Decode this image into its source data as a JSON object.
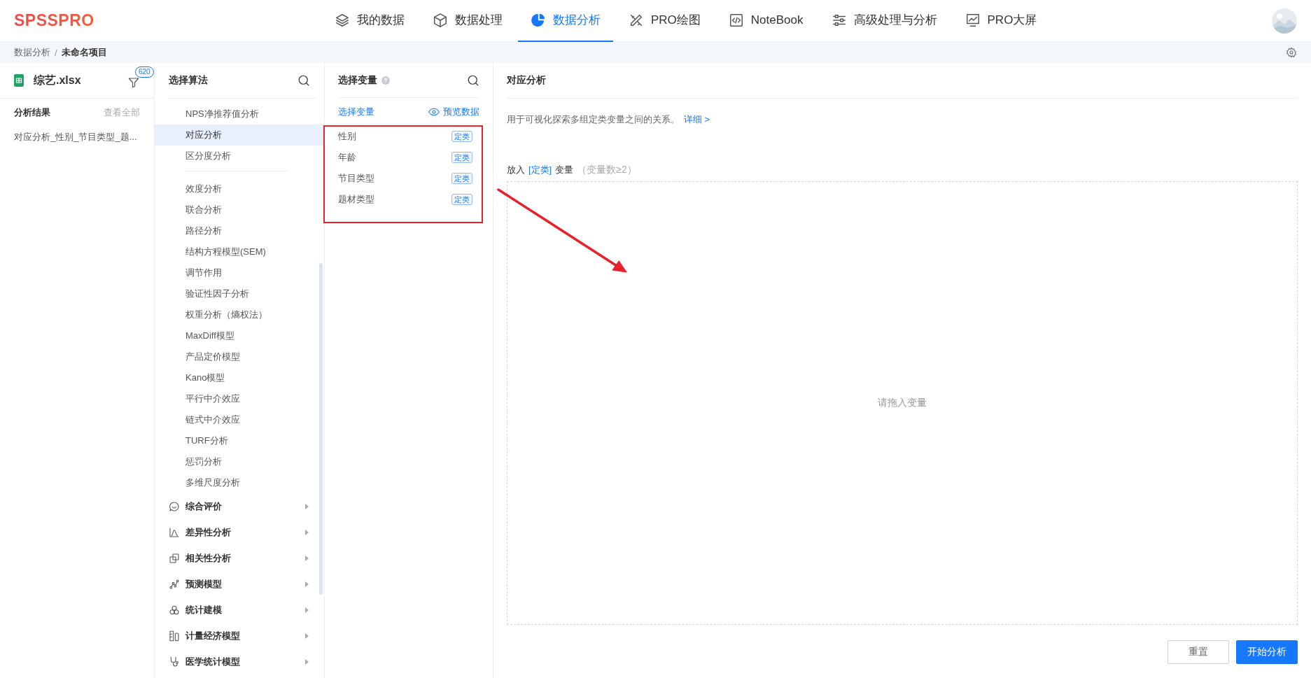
{
  "app": {
    "logo": "SPSSPRO"
  },
  "nav": [
    {
      "label": "我的数据",
      "selected": false
    },
    {
      "label": "数据处理",
      "selected": false
    },
    {
      "label": "数据分析",
      "selected": true
    },
    {
      "label": "PRO绘图",
      "selected": false
    },
    {
      "label": "NoteBook",
      "selected": false
    },
    {
      "label": "高级处理与分析",
      "selected": false
    },
    {
      "label": "PRO大屏",
      "selected": false
    }
  ],
  "breadcrumb": {
    "parent": "数据分析",
    "separator": "/",
    "current": "未命名项目"
  },
  "file_panel": {
    "file_name": "综艺.xlsx",
    "filter_count": "620",
    "results_title": "分析结果",
    "view_all": "查看全部",
    "results": [
      "对应分析_性别_节目类型_题..."
    ]
  },
  "algorithm_panel": {
    "title": "选择算法",
    "item_groups": [
      [
        {
          "label": "NPS净推荐值分析",
          "selected": false
        },
        {
          "label": "对应分析",
          "selected": true
        },
        {
          "label": "区分度分析",
          "selected": false
        }
      ],
      [
        {
          "label": "效度分析",
          "selected": false
        },
        {
          "label": "联合分析",
          "selected": false
        },
        {
          "label": "路径分析",
          "selected": false
        },
        {
          "label": "结构方程模型(SEM)",
          "selected": false
        },
        {
          "label": "调节作用",
          "selected": false
        },
        {
          "label": "验证性因子分析",
          "selected": false
        },
        {
          "label": "权重分析（熵权法）",
          "selected": false
        },
        {
          "label": "MaxDiff模型",
          "selected": false
        },
        {
          "label": "产品定价模型",
          "selected": false
        },
        {
          "label": "Kano模型",
          "selected": false
        },
        {
          "label": "平行中介效应",
          "selected": false
        },
        {
          "label": "链式中介效应",
          "selected": false
        },
        {
          "label": "TURF分析",
          "selected": false
        },
        {
          "label": "惩罚分析",
          "selected": false
        },
        {
          "label": "多维尺度分析",
          "selected": false
        }
      ]
    ],
    "categories": [
      {
        "label": "综合评价",
        "expanded": false
      },
      {
        "label": "差异性分析",
        "expanded": false
      },
      {
        "label": "相关性分析",
        "expanded": false
      },
      {
        "label": "预测模型",
        "expanded": false
      },
      {
        "label": "统计建模",
        "expanded": false
      },
      {
        "label": "计量经济模型",
        "expanded": false
      },
      {
        "label": "医学统计模型",
        "expanded": false
      }
    ]
  },
  "variable_panel": {
    "title": "选择变量",
    "tab": "选择变量",
    "preview": "预览数据",
    "variables": [
      {
        "name": "性别",
        "type": "定类"
      },
      {
        "name": "年龄",
        "type": "定类"
      },
      {
        "name": "节目类型",
        "type": "定类"
      },
      {
        "name": "题材类型",
        "type": "定类"
      }
    ]
  },
  "main": {
    "title": "对应分析",
    "description": "用于可视化探索多组定类变量之间的关系。",
    "detail_link": "详细 >",
    "drop_label": {
      "prefix": "放入",
      "type": "[定类]",
      "word": "变量",
      "hint": "（变量数≥2）"
    },
    "drop_placeholder": "请拖入变量",
    "reset_button": "重置",
    "start_button": "开始分析"
  }
}
